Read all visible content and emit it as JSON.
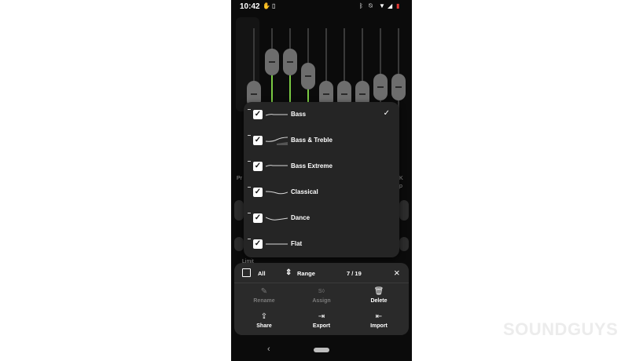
{
  "status_bar": {
    "time": "10:42",
    "icons": [
      "hand-icon",
      "sim-icon",
      "bluetooth-icon",
      "mute-icon",
      "wifi-icon",
      "signal-icon",
      "battery-low-icon"
    ]
  },
  "presets_menu": {
    "items": [
      {
        "label": "Bass",
        "checked": true,
        "selected": true
      },
      {
        "label": "Bass & Treble",
        "checked": true,
        "selected": false
      },
      {
        "label": "Bass Extreme",
        "checked": true,
        "selected": false
      },
      {
        "label": "Classical",
        "checked": true,
        "selected": false
      },
      {
        "label": "Dance",
        "checked": true,
        "selected": false
      },
      {
        "label": "Flat",
        "checked": true,
        "selected": false
      }
    ],
    "selected_tick": "✓"
  },
  "equalizer": {
    "band_levels": [
      0.42,
      0.78,
      0.78,
      0.62,
      0.42,
      0.42,
      0.42,
      0.5,
      0.5
    ]
  },
  "background_fragments": {
    "left_label": "Pr",
    "right_label_top": "K",
    "right_label_bottom": "p",
    "limit": "Limit"
  },
  "selection_bar": {
    "all_label": "All",
    "range_label": "Range",
    "count": "7 / 19",
    "close_icon": "×",
    "actions": [
      {
        "label": "Rename",
        "icon": "edit-icon",
        "glyph": "✎",
        "enabled": false
      },
      {
        "label": "Assign",
        "icon": "assign-icon",
        "glyph": "S◊",
        "enabled": false
      },
      {
        "label": "Delete",
        "icon": "trash-icon",
        "glyph": "🗑",
        "enabled": true
      },
      {
        "label": "Share",
        "icon": "share-icon",
        "glyph": "⇪",
        "enabled": true
      },
      {
        "label": "Export",
        "icon": "export-icon",
        "glyph": "⇥",
        "enabled": true
      },
      {
        "label": "Import",
        "icon": "import-icon",
        "glyph": "⇤",
        "enabled": true
      }
    ]
  },
  "navigation": {
    "back_glyph": "‹"
  },
  "watermark": {
    "text": "SOUNDGUYS"
  },
  "colors": {
    "accent_green": "#7ac943",
    "panel": "#252525",
    "background": "#0b0b0b"
  }
}
